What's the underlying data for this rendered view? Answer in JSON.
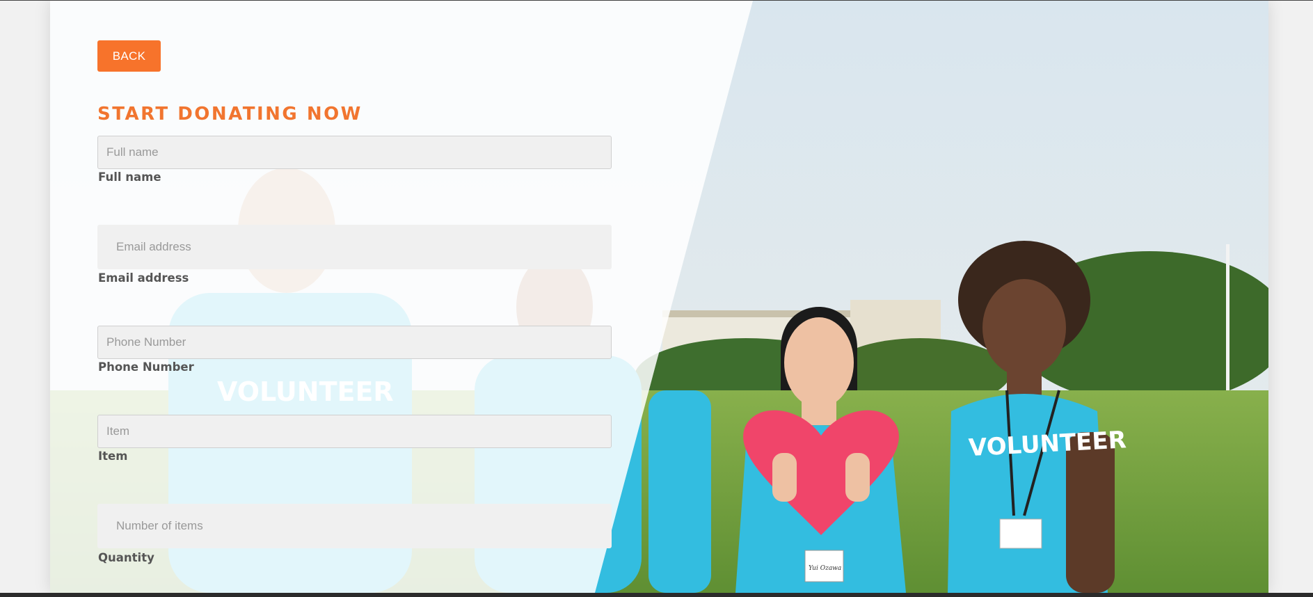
{
  "form": {
    "back_label": "BACK",
    "title": "START DONATING NOW",
    "fields": [
      {
        "placeholder": "Full name",
        "label": "Full name"
      },
      {
        "placeholder": "Email address",
        "label": "Email address"
      },
      {
        "placeholder": "Phone Number",
        "label": "Phone Number"
      },
      {
        "placeholder": "Item",
        "label": "Item"
      },
      {
        "placeholder": "Number of items",
        "label": "Quantity"
      }
    ]
  },
  "photo": {
    "shirt_text": "VOLUNTEER",
    "badge_text": "Yui Ozawa"
  },
  "colors": {
    "accent": "#f7732b",
    "title": "#f1752f",
    "shirt": "#33bde0",
    "heart": "#f0456a",
    "grass": "#7aab45",
    "sky": "#e3ebef"
  },
  "icons": [
    "heart-shape"
  ]
}
